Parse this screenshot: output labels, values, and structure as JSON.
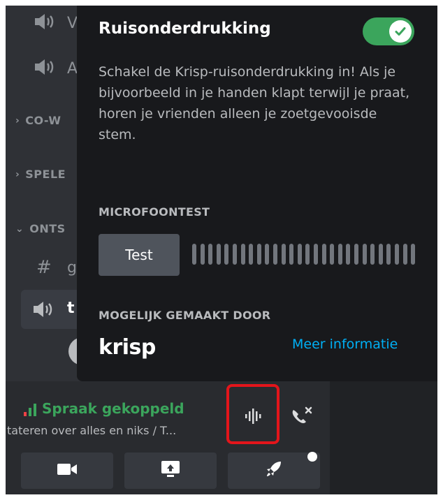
{
  "popup": {
    "title": "Ruisonderdrukking",
    "toggle_on": true,
    "description": "Schakel de Krisp-ruisonderdrukking in! Als je bijvoorbeeld in je handen klapt terwijl je praat, horen je vrienden alleen je zoetgevooisde stem.",
    "mic_test_label": "MICROFOONTEST",
    "test_button": "Test",
    "powered_by_label": "MOGELIJK GEMAAKT DOOR",
    "provider_logo_text": "krisp",
    "more_info_link": "Meer informatie"
  },
  "sidebar": {
    "partial_channels": [
      {
        "label": "V",
        "icon": "speaker-icon"
      },
      {
        "label": "A",
        "icon": "speaker-icon"
      }
    ],
    "categories": [
      {
        "label": "CO-W",
        "expanded": false
      },
      {
        "label": "SPELE",
        "expanded": false
      },
      {
        "label": "ONTS",
        "expanded": true
      }
    ],
    "text_channel_partial": "g",
    "active_voice_partial": "t"
  },
  "voice": {
    "status": "Spraak gekoppeld",
    "channel": "tateren over alles en niks / T..."
  },
  "colors": {
    "accent_green": "#3ba55c",
    "link_blue": "#00aff4",
    "annotation_red": "#e3151b"
  }
}
